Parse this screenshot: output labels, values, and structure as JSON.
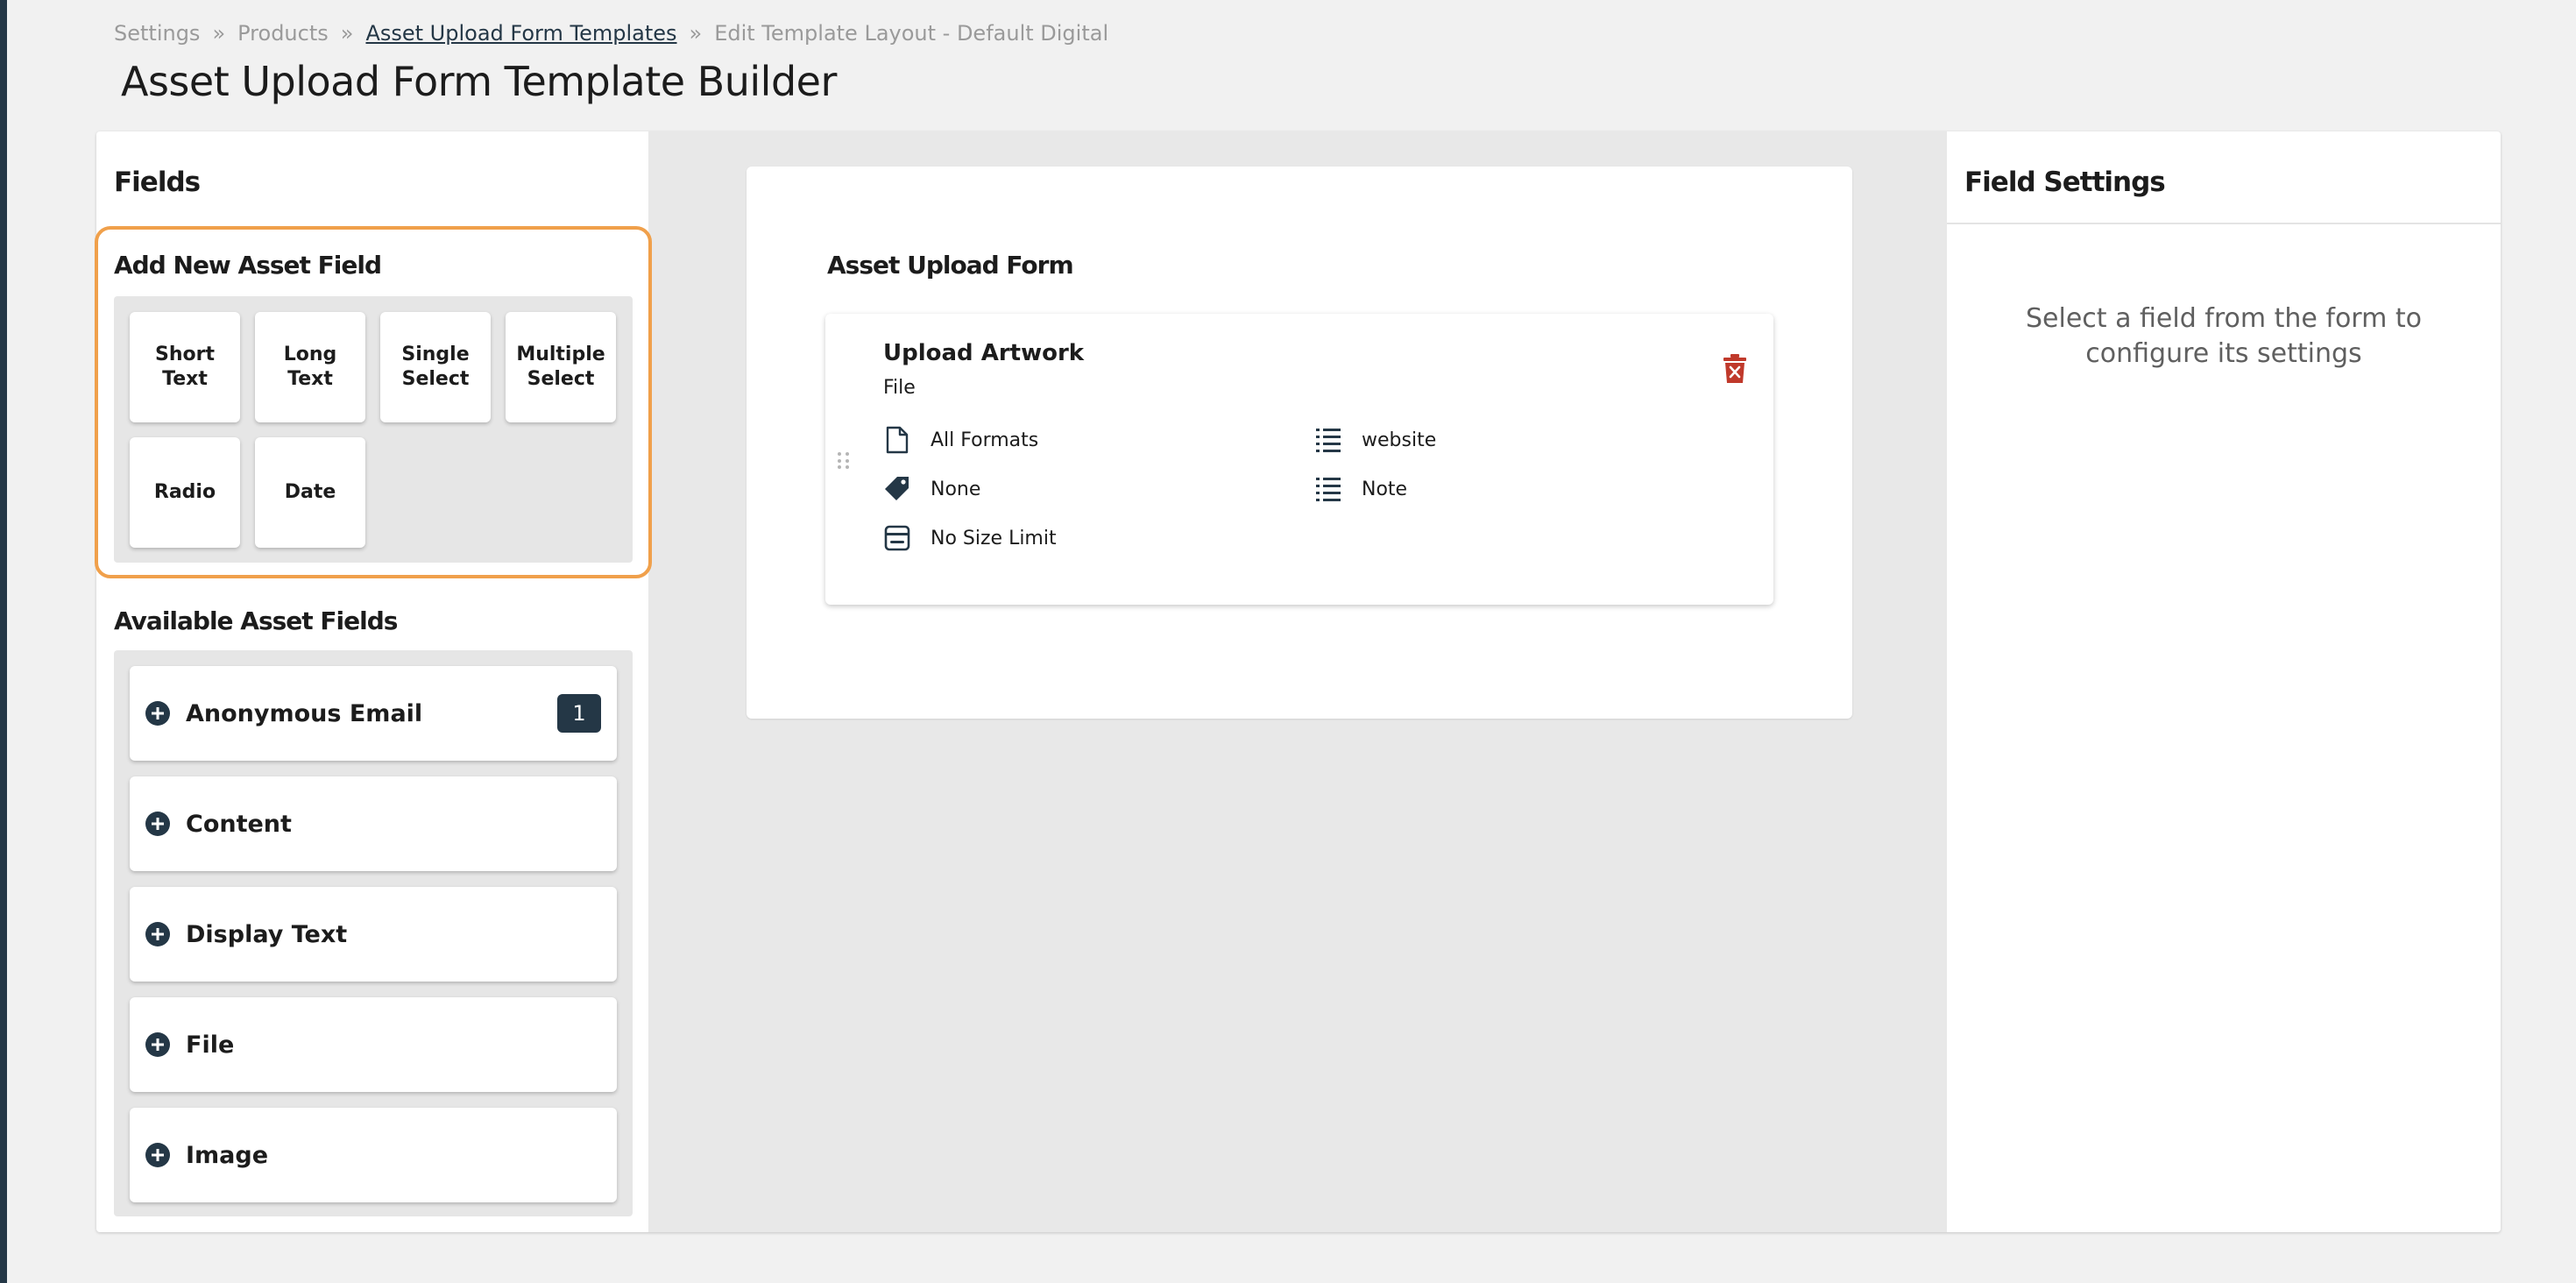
{
  "breadcrumb": {
    "items": [
      "Settings",
      "Products",
      "Asset Upload Form Templates",
      "Edit Template Layout - Default Digital"
    ],
    "separator": "»"
  },
  "page_title": "Asset Upload Form Template Builder",
  "fields_panel": {
    "heading": "Fields",
    "add_new": {
      "title": "Add New Asset Field",
      "types": [
        "Short Text",
        "Long Text",
        "Single Select",
        "Multiple Select",
        "Radio",
        "Date"
      ]
    },
    "available": {
      "title": "Available Asset Fields",
      "items": [
        {
          "label": "Anonymous Email",
          "count": "1",
          "icon": "plus-circle-icon"
        },
        {
          "label": "Content",
          "icon": "plus-circle-icon"
        },
        {
          "label": "Display Text",
          "icon": "plus-circle-icon"
        },
        {
          "label": "File",
          "icon": "plus-circle-icon"
        },
        {
          "label": "Image",
          "icon": "plus-circle-icon"
        }
      ]
    }
  },
  "form": {
    "title": "Asset Upload Form",
    "field": {
      "name": "Upload Artwork",
      "type": "File",
      "props_left": [
        {
          "icon": "file-icon",
          "text": "All Formats"
        },
        {
          "icon": "tag-icon",
          "text": "None"
        },
        {
          "icon": "storage-icon",
          "text": "No Size Limit"
        }
      ],
      "props_right": [
        {
          "icon": "list-icon",
          "text": "website"
        },
        {
          "icon": "list-icon",
          "text": "Note"
        }
      ]
    }
  },
  "settings_panel": {
    "heading": "Field Settings",
    "empty_message": "Select a field from the form to configure its settings"
  },
  "colors": {
    "navy": "#243746",
    "highlight_orange": "#f0a04b",
    "delete_red": "#c0392b",
    "background": "#f1f1f1"
  }
}
